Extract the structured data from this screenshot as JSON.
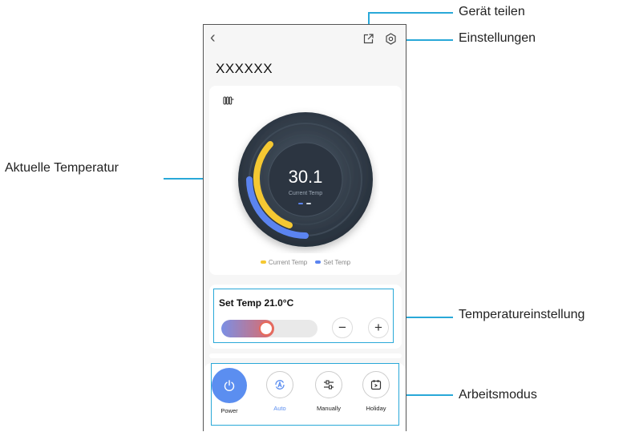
{
  "app": {
    "back_glyph": "‹",
    "device_name": "XXXXXX"
  },
  "gauge": {
    "current_temp": "30.1",
    "current_label": "Current Temp",
    "legend_current": "Current Temp",
    "legend_set": "Set Temp",
    "colors": {
      "current": "#f5c832",
      "set": "#5b84f0"
    }
  },
  "set_temp": {
    "title": "Set Temp 21.0°C",
    "slider_level": 0.55,
    "minus_glyph": "−",
    "plus_glyph": "+"
  },
  "modes": [
    {
      "label": "Power",
      "icon": "power-icon",
      "active": false
    },
    {
      "label": "Auto",
      "icon": "auto-mode-icon",
      "active": true
    },
    {
      "label": "Manually",
      "icon": "sliders-icon",
      "active": false
    },
    {
      "label": "Holiday",
      "icon": "calendar-icon",
      "active": false
    }
  ],
  "annotations": {
    "share": "Gerät teilen",
    "settings": "Einstellungen",
    "current_temp": "Aktuelle Temperatur",
    "temp_setting": "Temperatureinstellung",
    "work_mode": "Arbeitsmodus"
  }
}
